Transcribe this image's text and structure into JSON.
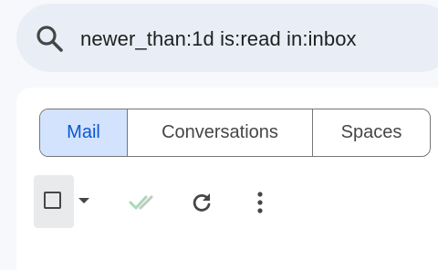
{
  "search": {
    "icon": "search-icon",
    "query": "newer_than:1d is:read in:inbox"
  },
  "tabs": [
    {
      "label": "Mail",
      "active": true
    },
    {
      "label": "Conversations",
      "active": false
    },
    {
      "label": "Spaces",
      "active": false
    }
  ],
  "toolbar": {
    "select_icon": "checkbox-icon",
    "select_menu_icon": "caret-down-icon",
    "mark_read_icon": "double-check-icon",
    "refresh_icon": "refresh-icon",
    "more_icon": "more-vert-icon"
  },
  "colors": {
    "background": "#f6f8fc",
    "search_bg": "#e9eef6",
    "active_tab_bg": "#d3e3fd",
    "active_tab_text": "#0b57d0",
    "check_green": "#a8dab5"
  }
}
